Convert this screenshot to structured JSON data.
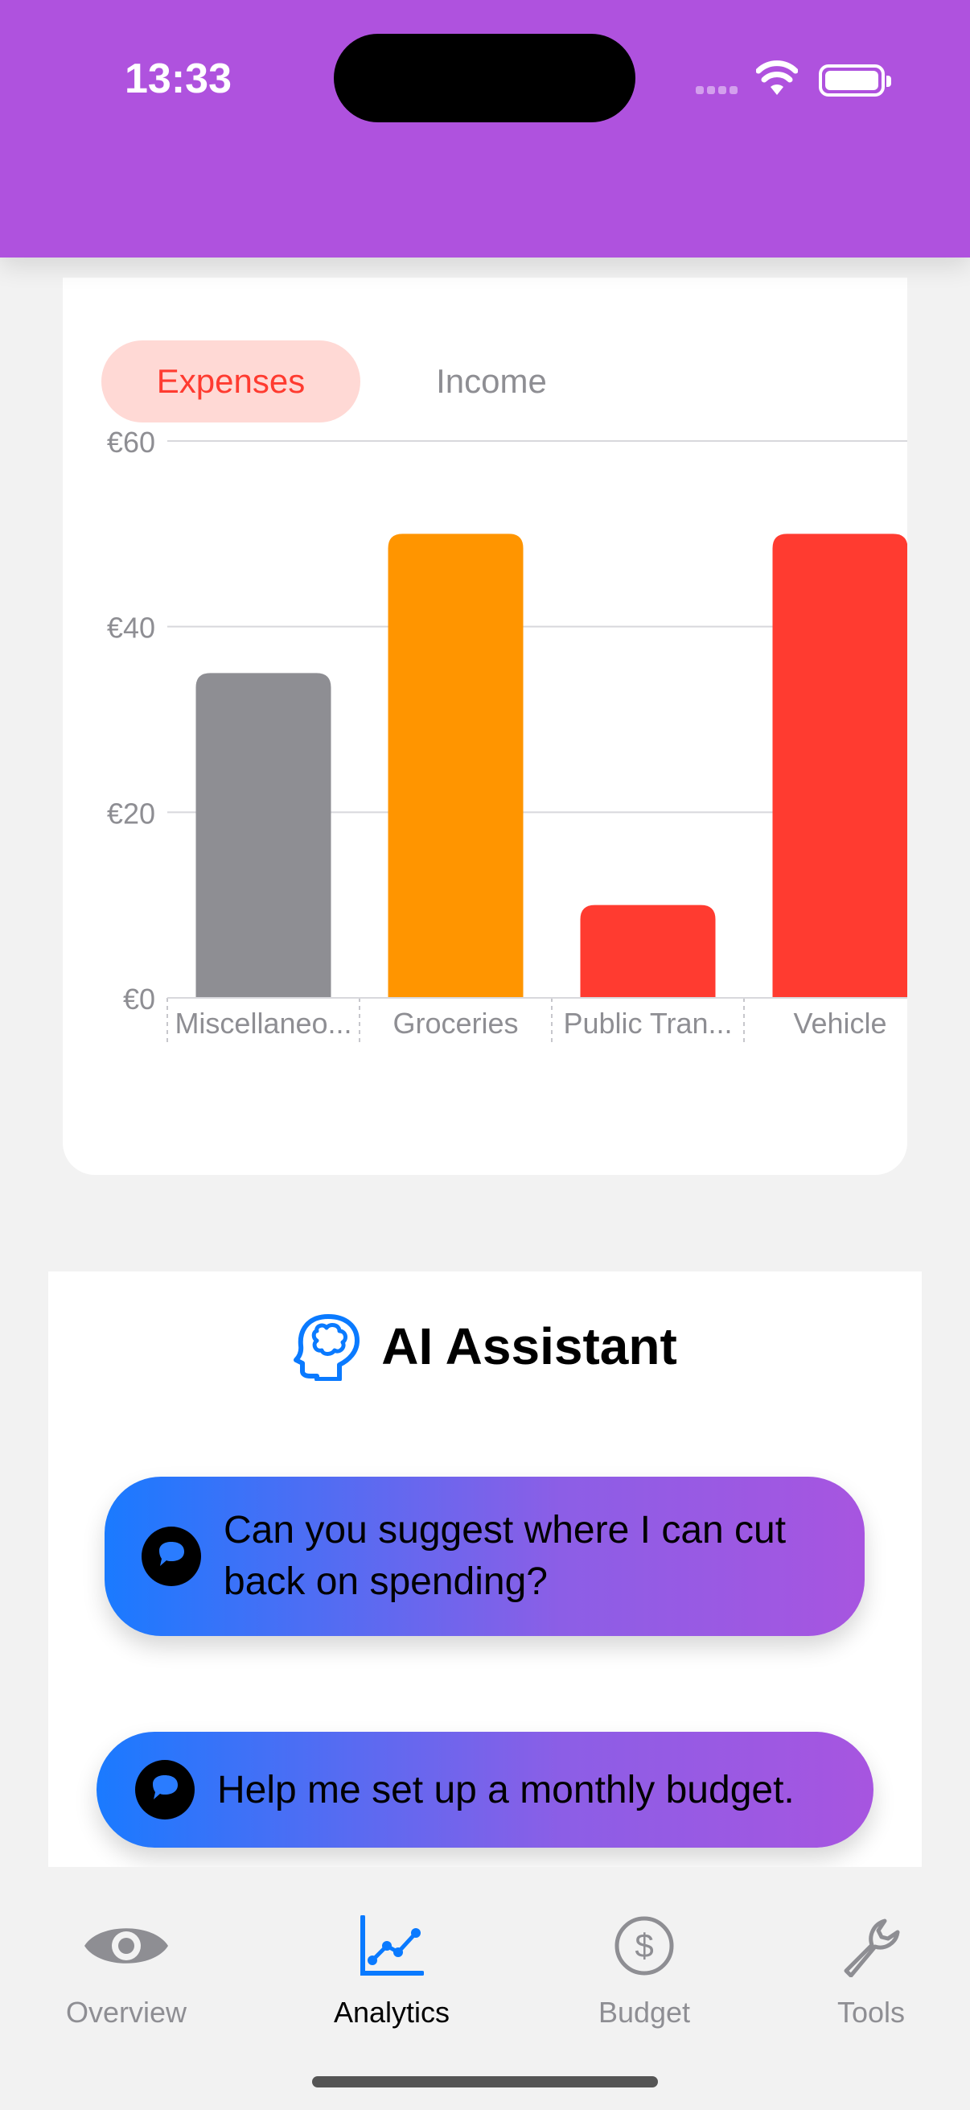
{
  "status_bar": {
    "time": "13:33"
  },
  "segments": {
    "expenses": "Expenses",
    "income": "Income"
  },
  "chart_data": {
    "type": "bar",
    "categories": [
      "Miscellaneo...",
      "Groceries",
      "Public Tran...",
      "Vehicle"
    ],
    "values": [
      35,
      50,
      10,
      50
    ],
    "colors": [
      "#8e8e93",
      "#ff9500",
      "#ff3b30",
      "#ff3b30"
    ],
    "y_ticks": [
      "€0",
      "€20",
      "€40",
      "€60"
    ],
    "ylim": [
      0,
      60
    ],
    "grid": true
  },
  "assistant": {
    "title": "AI Assistant",
    "title_icon": "brain-head-icon",
    "suggestion_1": "Can you suggest where I can cut back on spending?",
    "suggestion_2": "Help me set up a monthly budget.",
    "suggestion_icon": "chat-bubble-icon"
  },
  "tabs": [
    {
      "label": "Overview",
      "icon": "eye-icon",
      "active": false
    },
    {
      "label": "Analytics",
      "icon": "chart-icon",
      "active": true
    },
    {
      "label": "Budget",
      "icon": "dollar-icon",
      "active": false
    },
    {
      "label": "Tools",
      "icon": "wrench-icon",
      "active": false
    }
  ],
  "colors": {
    "accent": "#af52de",
    "active_tab": "#0a7aff",
    "expense": "#ff3b30"
  }
}
